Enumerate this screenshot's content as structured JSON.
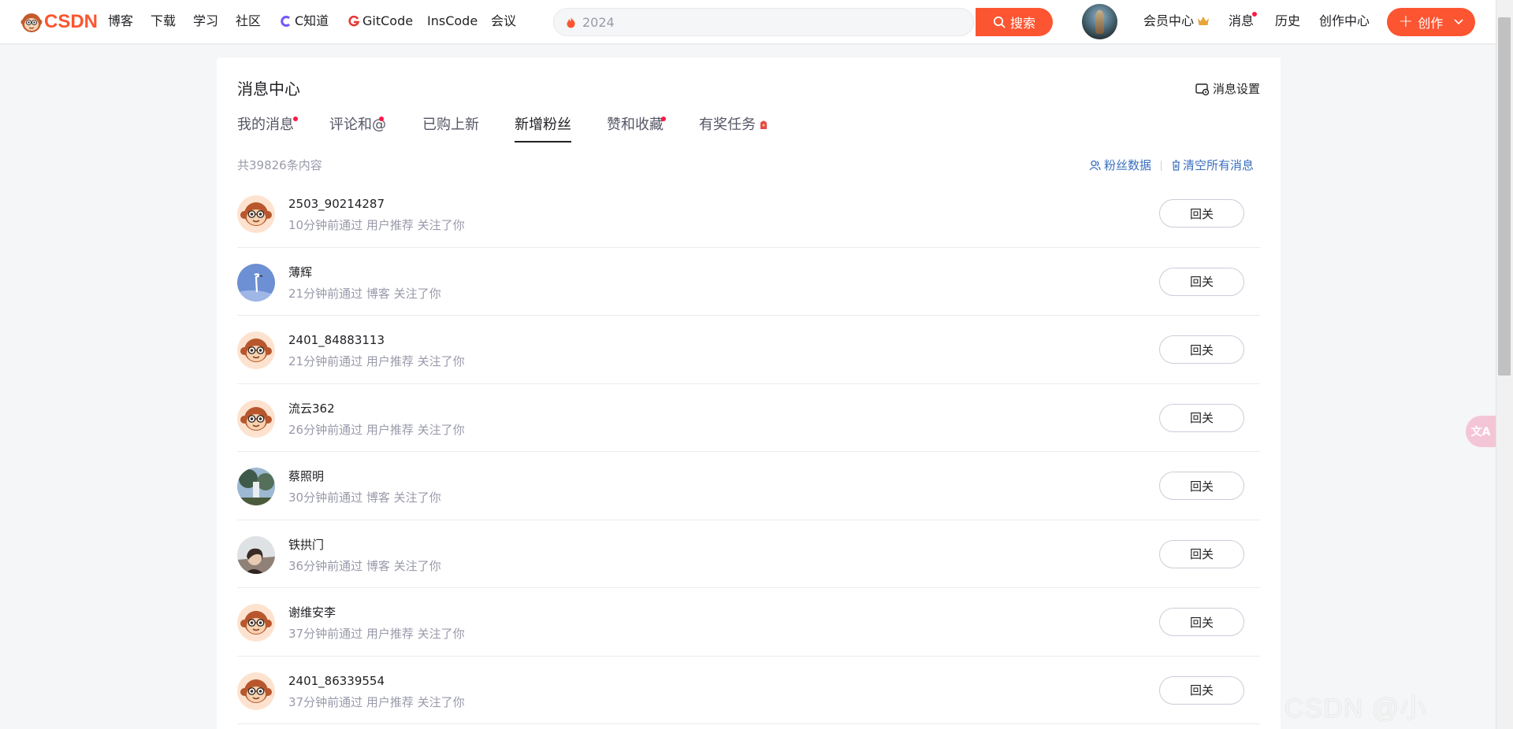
{
  "nav": {
    "logo_text": "CSDN",
    "items": [
      "博客",
      "下载",
      "学习",
      "社区",
      "C知道",
      "GitCode",
      "InsCode",
      "会议"
    ],
    "search": {
      "placeholder": "2024",
      "button_label": "搜索"
    },
    "right_items": {
      "vip": "会员中心",
      "messages": "消息",
      "history": "历史",
      "creator": "创作中心"
    },
    "create_label": "创作",
    "brand_color": "#fc5531"
  },
  "page": {
    "title": "消息中心",
    "settings_label": "消息设置",
    "tabs": [
      {
        "label": "我的消息",
        "badge": true
      },
      {
        "label": "评论和@",
        "badge": true
      },
      {
        "label": "已购上新",
        "badge": false
      },
      {
        "label": "新增粉丝",
        "badge": false,
        "active": true
      },
      {
        "label": "赞和收藏",
        "badge": true
      },
      {
        "label": "有奖任务",
        "badge": false
      }
    ],
    "total": "共39826条内容",
    "fans_data_label": "粉丝数据",
    "clear_label": "清空所有消息"
  },
  "fans": [
    {
      "name": "2503_90214287",
      "meta": "10分钟前通过 用户推荐 关注了你",
      "button": "回关",
      "avatar": "monkey-avatar"
    },
    {
      "name": "薄辉",
      "meta": "21分钟前通过 博客 关注了你",
      "button": "回关",
      "avatar": "crane-avatar"
    },
    {
      "name": "2401_84883113",
      "meta": "21分钟前通过 用户推荐 关注了你",
      "button": "回关",
      "avatar": "monkey-avatar"
    },
    {
      "name": "流云362",
      "meta": "26分钟前通过 用户推荐 关注了你",
      "button": "回关",
      "avatar": "monkey-avatar"
    },
    {
      "name": "蔡照明",
      "meta": "30分钟前通过 博客 关注了你",
      "button": "回关",
      "avatar": "tree-photo-avatar"
    },
    {
      "name": "铁拱门",
      "meta": "36分钟前通过 博客 关注了你",
      "button": "回关",
      "avatar": "girl-photo-avatar"
    },
    {
      "name": "谢维安李",
      "meta": "37分钟前通过 用户推荐 关注了你",
      "button": "回关",
      "avatar": "monkey-avatar"
    },
    {
      "name": "2401_86339554",
      "meta": "37分钟前通过 用户推荐 关注了你",
      "button": "回关",
      "avatar": "monkey-avatar"
    }
  ],
  "watermark": "CSDN @小"
}
